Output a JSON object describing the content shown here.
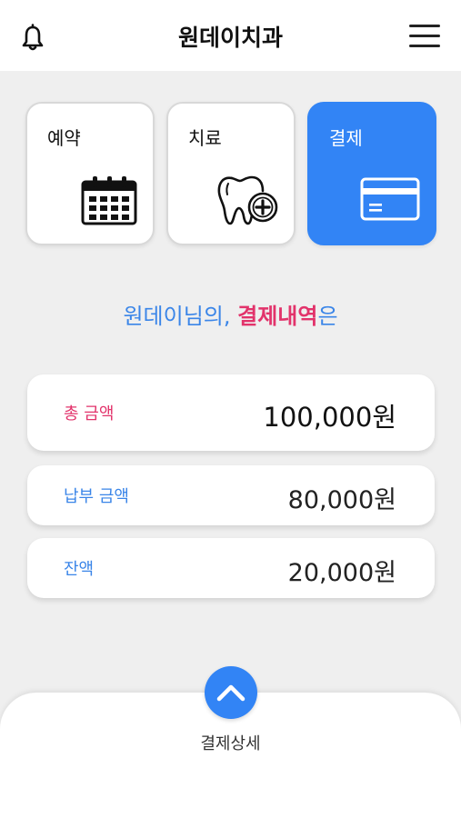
{
  "header": {
    "title": "원데이치과",
    "notification_icon": "bell-icon",
    "menu_icon": "hamburger-menu-icon"
  },
  "tabs": [
    {
      "label": "예약",
      "icon": "calendar-icon",
      "active": false
    },
    {
      "label": "치료",
      "icon": "tooth-plus-icon",
      "active": false
    },
    {
      "label": "결제",
      "icon": "credit-card-icon",
      "active": true
    }
  ],
  "headline": {
    "prefix": "원데이님의, ",
    "highlight": "결제내역",
    "suffix": "은"
  },
  "summary": {
    "total": {
      "label": "총 금액",
      "value": "100,000원"
    },
    "paid": {
      "label": "납부 금액",
      "value": "80,000원"
    },
    "balance": {
      "label": "잔액",
      "value": "20,000원"
    }
  },
  "bottom_sheet": {
    "label": "결제상세",
    "toggle_icon": "chevron-up-icon"
  },
  "colors": {
    "accent_blue": "#3284f5",
    "text_blue": "#3a85e8",
    "highlight_pink": "#e2336b",
    "background": "#efefef"
  }
}
